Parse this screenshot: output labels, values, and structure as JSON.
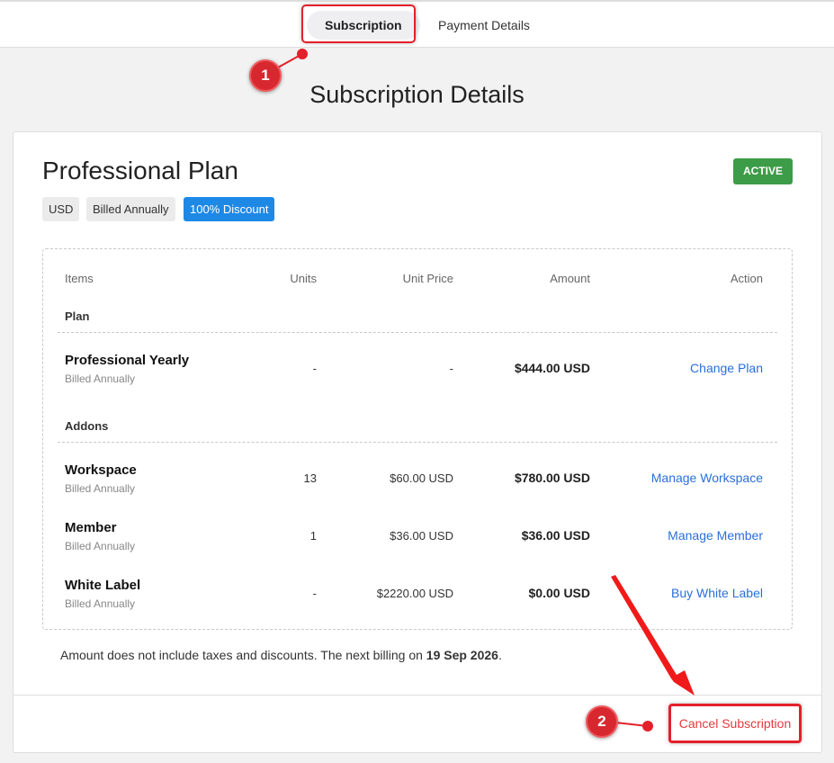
{
  "tabs": {
    "subscription": "Subscription",
    "payment": "Payment Details"
  },
  "page_title": "Subscription Details",
  "plan": {
    "name": "Professional Plan",
    "status": "ACTIVE",
    "chips": [
      "USD",
      "Billed Annually",
      "100% Discount"
    ]
  },
  "table": {
    "headers": {
      "items": "Items",
      "units": "Units",
      "unit_price": "Unit Price",
      "amount": "Amount",
      "action": "Action"
    },
    "plan_section": "Plan",
    "addons_section": "Addons",
    "rows": [
      {
        "name": "Professional Yearly",
        "billing": "Billed Annually",
        "units": "-",
        "unit_price": "-",
        "amount": "$444.00 USD",
        "action": "Change Plan"
      },
      {
        "name": "Workspace",
        "billing": "Billed Annually",
        "units": "13",
        "unit_price": "$60.00 USD",
        "amount": "$780.00 USD",
        "action": "Manage Workspace"
      },
      {
        "name": "Member",
        "billing": "Billed Annually",
        "units": "1",
        "unit_price": "$36.00 USD",
        "amount": "$36.00 USD",
        "action": "Manage Member"
      },
      {
        "name": "White Label",
        "billing": "Billed Annually",
        "units": "-",
        "unit_price": "$2220.00 USD",
        "amount": "$0.00 USD",
        "action": "Buy White Label"
      }
    ]
  },
  "note": {
    "text": "Amount does not include taxes and discounts. The next billing on ",
    "date": "19 Sep 2026",
    "end": "."
  },
  "cancel_label": "Cancel Subscription",
  "annotations": {
    "one": "1",
    "two": "2"
  }
}
